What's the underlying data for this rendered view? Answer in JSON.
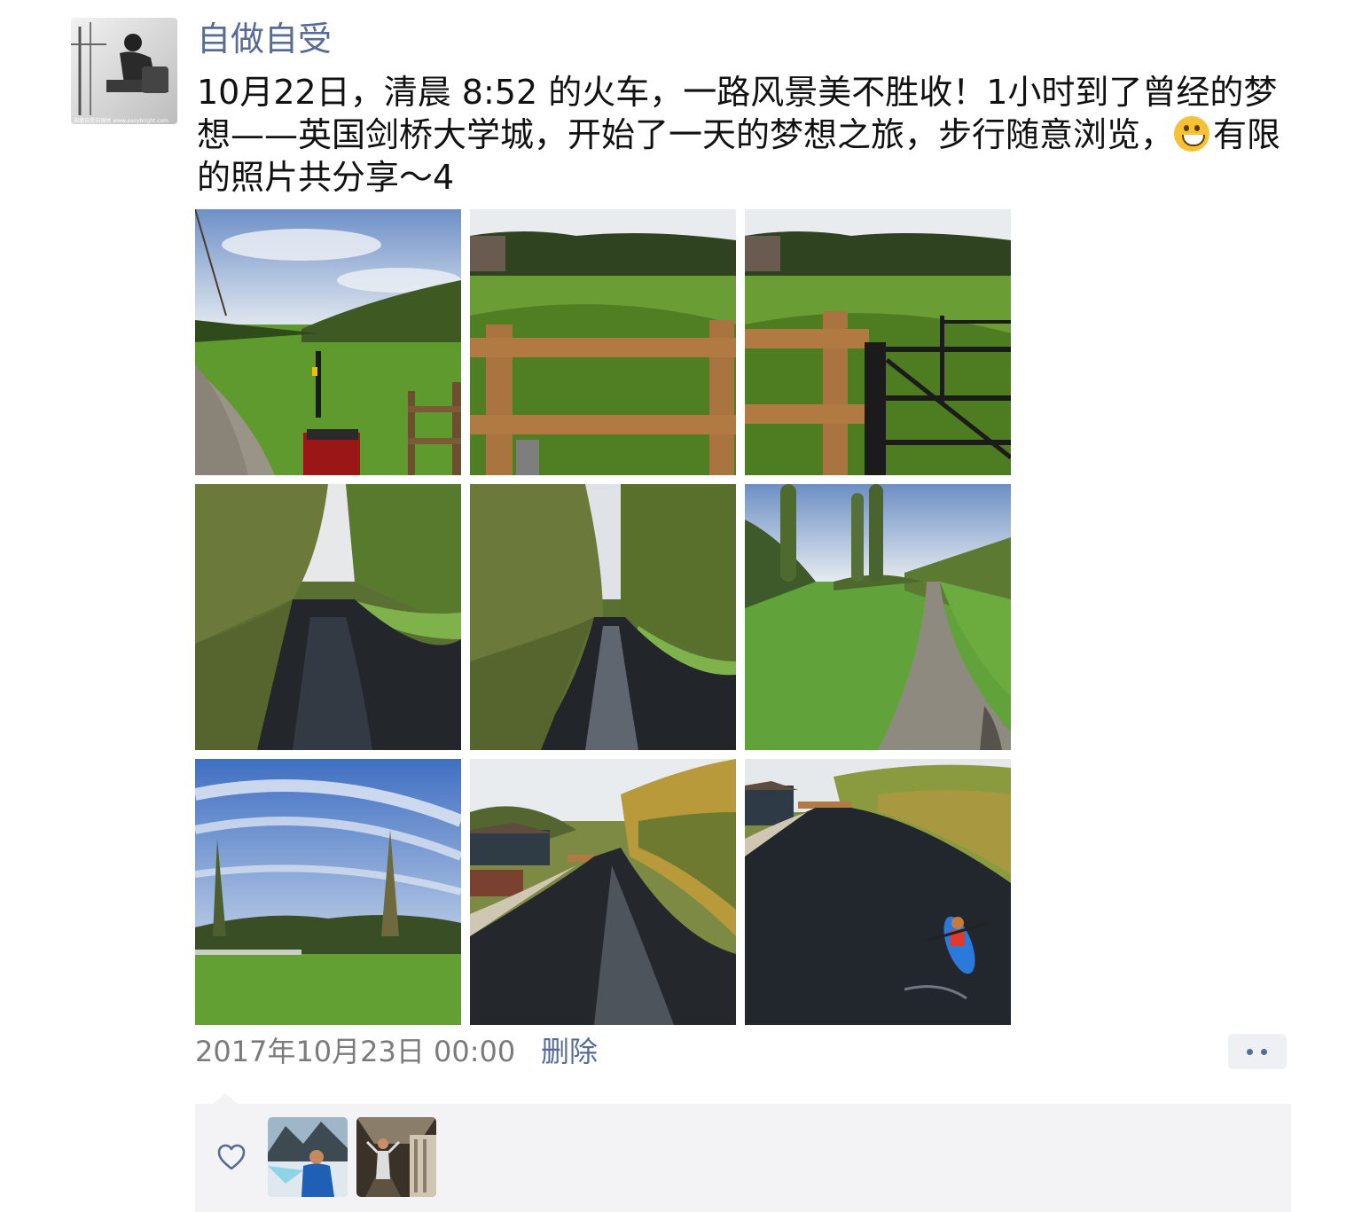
{
  "post": {
    "author": "自做自受",
    "text": "10月22日，清晨 8:52 的火车，一路风景美不胜收！1小时到了曾经的梦想——英国剑桥大学城，开始了一天的梦想之旅，步行随意浏览，",
    "text_tail": "有限的照片共分享～4",
    "emoji": "grinning-face-icon",
    "avatar_caption": "自做自受自媒体 www.easybright.com",
    "photos": [
      {
        "name": "photo-meadow-path"
      },
      {
        "name": "photo-meadow-fence"
      },
      {
        "name": "photo-meadow-gate"
      },
      {
        "name": "photo-river-trees-1"
      },
      {
        "name": "photo-river-trees-2"
      },
      {
        "name": "photo-towpath"
      },
      {
        "name": "photo-blue-sky-field"
      },
      {
        "name": "photo-river-boathouse"
      },
      {
        "name": "photo-river-kayak"
      }
    ],
    "timestamp": "2017年10月23日 00:00",
    "delete_label": "删除",
    "likers": [
      {
        "name": "liker-avatar-1"
      },
      {
        "name": "liker-avatar-2"
      }
    ]
  },
  "colors": {
    "link": "#576b95",
    "text": "#111111",
    "meta": "#7b7b7b",
    "likes_bg": "#f3f3f5"
  }
}
